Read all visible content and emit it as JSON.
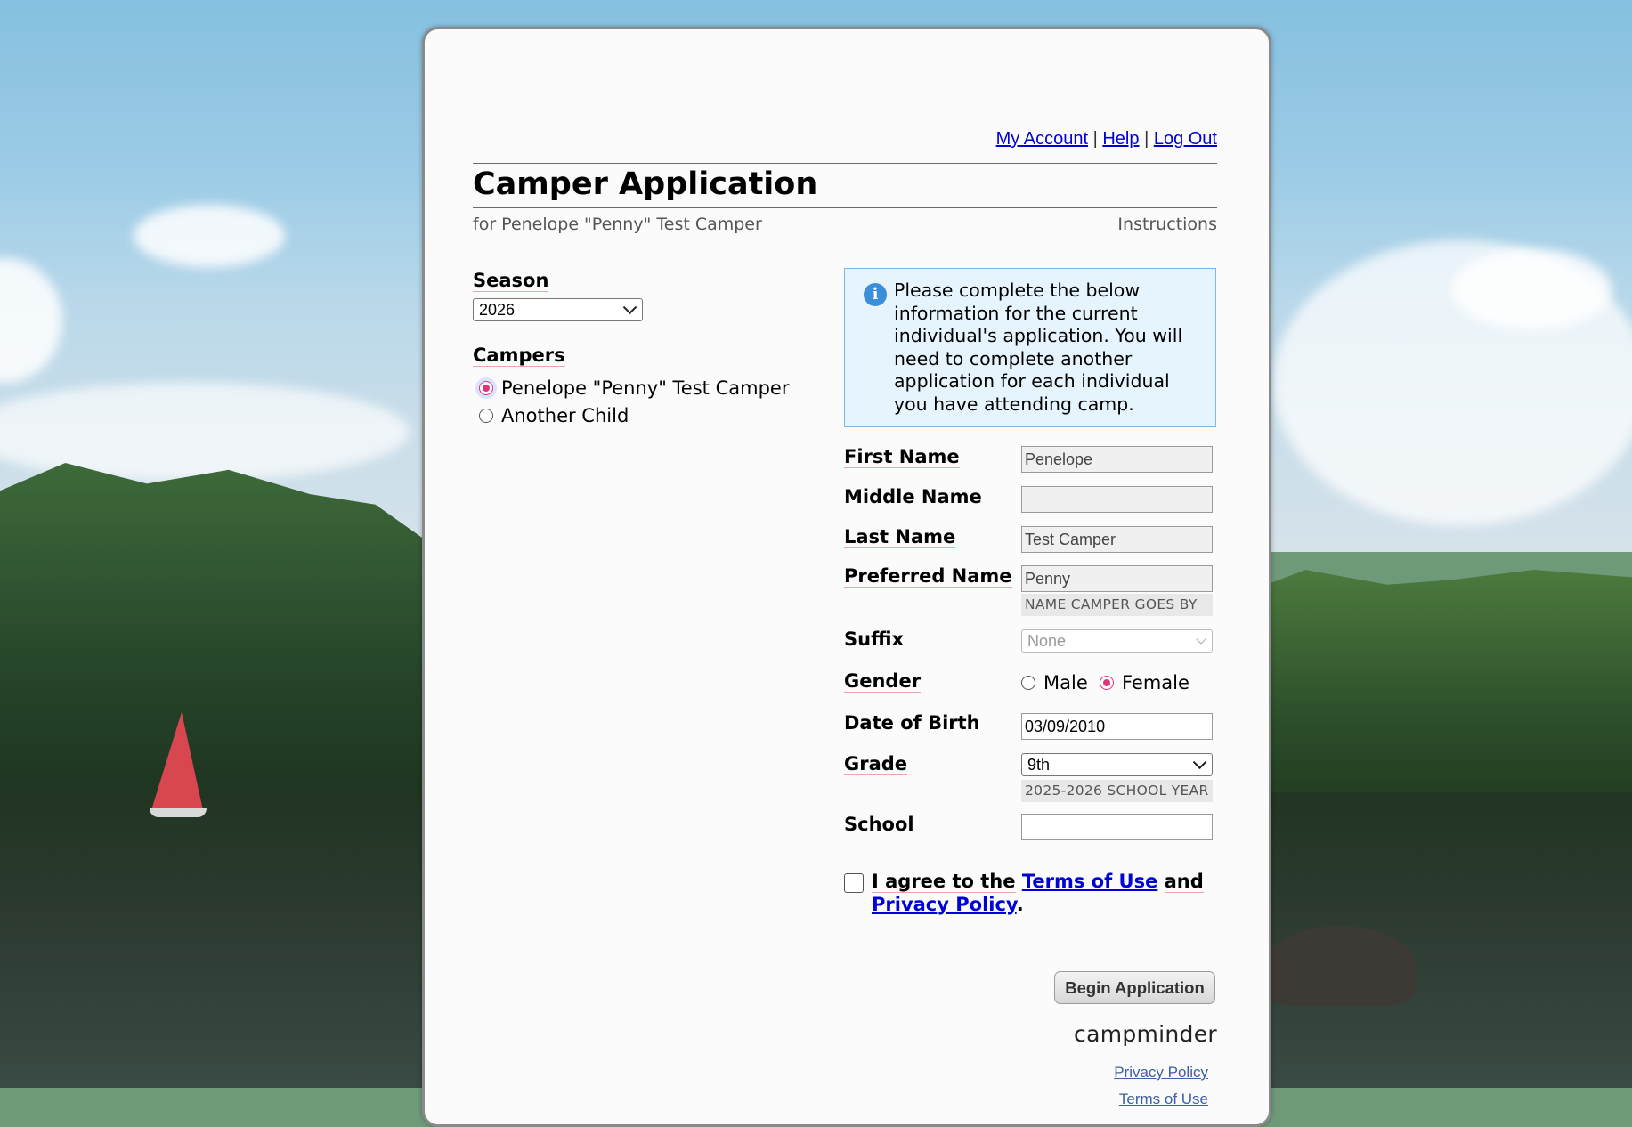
{
  "nav": {
    "my_account": "My Account",
    "help": "Help",
    "log_out": "Log Out",
    "sep": "|"
  },
  "page": {
    "title": "Camper Application",
    "subtitle": "for Penelope \"Penny\" Test Camper",
    "instructions": "Instructions"
  },
  "season": {
    "label": "Season",
    "value": "2026"
  },
  "campers": {
    "label": "Campers",
    "options": [
      {
        "label": "Penelope \"Penny\" Test Camper",
        "selected": true
      },
      {
        "label": "Another Child",
        "selected": false
      }
    ]
  },
  "info": {
    "icon": "info-icon",
    "text": "Please complete the below information for the current individual's application. You will need to complete another application for each individual you have attending camp."
  },
  "form": {
    "first_name": {
      "label": "First Name",
      "value": "Penelope"
    },
    "middle_name": {
      "label": "Middle Name",
      "value": ""
    },
    "last_name": {
      "label": "Last Name",
      "value": "Test Camper"
    },
    "preferred_name": {
      "label": "Preferred Name",
      "value": "Penny",
      "hint": "NAME CAMPER GOES BY"
    },
    "suffix": {
      "label": "Suffix",
      "value": "None"
    },
    "gender": {
      "label": "Gender",
      "options": [
        "Male",
        "Female"
      ],
      "selected": "Female"
    },
    "dob": {
      "label": "Date of Birth",
      "value": "03/09/2010"
    },
    "grade": {
      "label": "Grade",
      "value": "9th",
      "hint": "2025-2026 SCHOOL YEAR"
    },
    "school": {
      "label": "School",
      "value": ""
    }
  },
  "agree": {
    "prefix": "I agree to the",
    "terms": "Terms of Use",
    "and": "and",
    "privacy": "Privacy Policy",
    "period": "."
  },
  "button": {
    "begin": "Begin Application"
  },
  "footer": {
    "brand": "campminder",
    "privacy": "Privacy Policy",
    "terms": "Terms of Use"
  },
  "colors": {
    "link": "#0000d8",
    "accent": "#e0357d",
    "info_bg": "#e6f4fd",
    "info_border": "#7fb7e0"
  }
}
